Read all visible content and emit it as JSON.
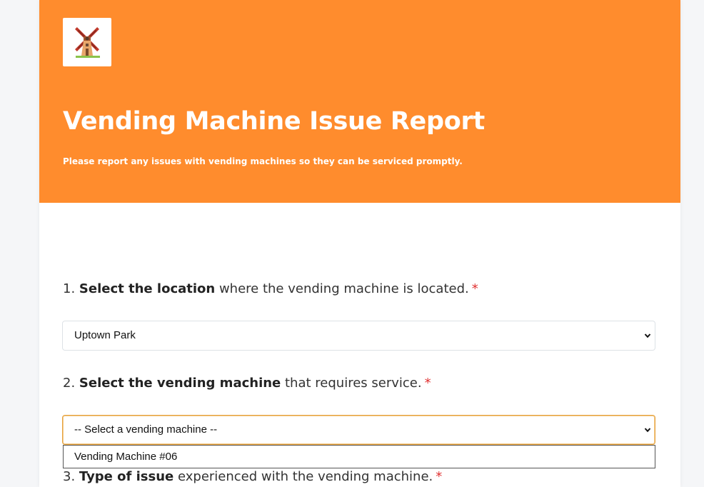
{
  "header": {
    "logo_icon": "windmill-icon",
    "title": "Vending Machine Issue Report",
    "subtitle": "Please report any issues with vending machines so they can be serviced promptly.",
    "background_color": "#ff8c2d"
  },
  "questions": [
    {
      "number": "1.",
      "bold": "Select the location",
      "rest": "where the vending machine is located.",
      "required_mark": "*",
      "selected_value": "Uptown Park"
    },
    {
      "number": "2.",
      "bold": "Select the vending machine",
      "rest": "that requires service.",
      "required_mark": "*",
      "selected_value": "-- Select a vending machine --",
      "open_options": [
        "Vending Machine #06"
      ]
    },
    {
      "number": "3.",
      "bold": "Type of issue",
      "rest": "experienced with the vending machine.",
      "required_mark": "*"
    }
  ],
  "colors": {
    "required": "#e03131",
    "focus_border": "#e6a23c"
  }
}
